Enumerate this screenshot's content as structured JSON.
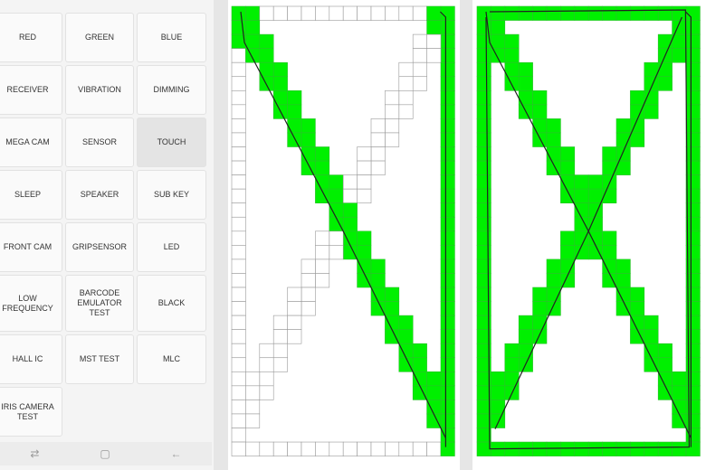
{
  "menu": {
    "buttons": [
      [
        "RED",
        "GREEN",
        "BLUE"
      ],
      [
        "RECEIVER",
        "VIBRATION",
        "DIMMING"
      ],
      [
        "MEGA CAM",
        "SENSOR",
        "TOUCH"
      ],
      [
        "SLEEP",
        "SPEAKER",
        "SUB KEY"
      ],
      [
        "FRONT CAM",
        "GRIPSENSOR",
        "LED"
      ],
      [
        "LOW FREQUENCY",
        "BARCODE\nEMULATOR TEST",
        "BLACK"
      ],
      [
        "HALL IC",
        "MST TEST",
        "MLC"
      ],
      [
        "IRIS CAMERA TEST"
      ]
    ],
    "active": "TOUCH"
  },
  "nav": {
    "recent": "⇄",
    "home": "▢",
    "back": "←"
  },
  "touch_test": {
    "columns": 16,
    "rows": 32,
    "touched_color": "#00f000",
    "untouched_color": "#ffffff"
  }
}
